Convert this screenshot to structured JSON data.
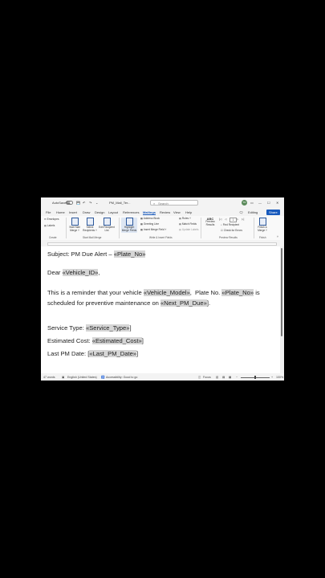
{
  "titlebar": {
    "autosave_label": "AutoSave",
    "toggle_state": "Off",
    "file_name": "PM_Mail_Ter...",
    "search_placeholder": "Search",
    "user_initials": "TR",
    "minimize": "—",
    "maximize": "☐",
    "close": "✕"
  },
  "tabs": [
    "File",
    "Home",
    "Insert",
    "Draw",
    "Design",
    "Layout",
    "References",
    "Mailings",
    "Review",
    "View",
    "Help"
  ],
  "active_tab": "Mailings",
  "tab_actions": {
    "comment_icon": "comment-icon",
    "editing_label": "Editing",
    "share_label": "Share"
  },
  "ribbon": {
    "create": {
      "envelopes": "Envelopes",
      "labels": "Labels",
      "group": "Create"
    },
    "start": {
      "start_mail_merge": "Start Mail Merge ˅",
      "select_recipients": "Select Recipients ˅",
      "edit_recipient_list": "Edit Recipient List",
      "group": "Start Mail Merge"
    },
    "write": {
      "highlight_merge_fields": "Highlight Merge Fields",
      "address_block": "Address Block",
      "greeting_line": "Greeting Line",
      "insert_merge_field": "Insert Merge Field ˅",
      "rules": "Rules ˅",
      "match_fields": "Match Fields",
      "update_labels": "Update Labels",
      "group": "Write & Insert Fields"
    },
    "preview": {
      "abc": "ABC",
      "preview_results": "Preview Results",
      "record_number": "1",
      "find_recipient": "Find Recipient",
      "check_for_errors": "Check for Errors",
      "group": "Preview Results"
    },
    "finish": {
      "finish_merge": "Finish & Merge ˅",
      "group": "Finish"
    }
  },
  "document": {
    "line1": {
      "text": "Subject: PM Due Alert – ",
      "field": "«Plate_No»"
    },
    "line2": {
      "text": "Dear ",
      "field": "«Vehicle_ID»",
      "after": ","
    },
    "line3": {
      "text": "This is a reminder that your vehicle ",
      "field1": "«Vehicle_Model»",
      "mid": ",  Plate No. ",
      "field2": "«Plate_No»",
      "end": " is"
    },
    "line4": {
      "text": "scheduled for preventive maintenance on ",
      "field": "«Next_PM_Due»",
      "after": "]."
    },
    "line5": {
      "text": "Service Type: ",
      "field": "«Service_Type»",
      "after": "]"
    },
    "line6": {
      "text": "Estimated Cost: ",
      "field": "«Estimated_Cost»",
      "after": "]"
    },
    "line7": {
      "text": "Last PM Date: [",
      "field": "«Last_PM_Date»",
      "after": "]"
    }
  },
  "statusbar": {
    "words": "47 words",
    "language": "English (United States)",
    "accessibility": "Accessibility: Good to go",
    "focus": "Focus",
    "zoom": "100%"
  }
}
